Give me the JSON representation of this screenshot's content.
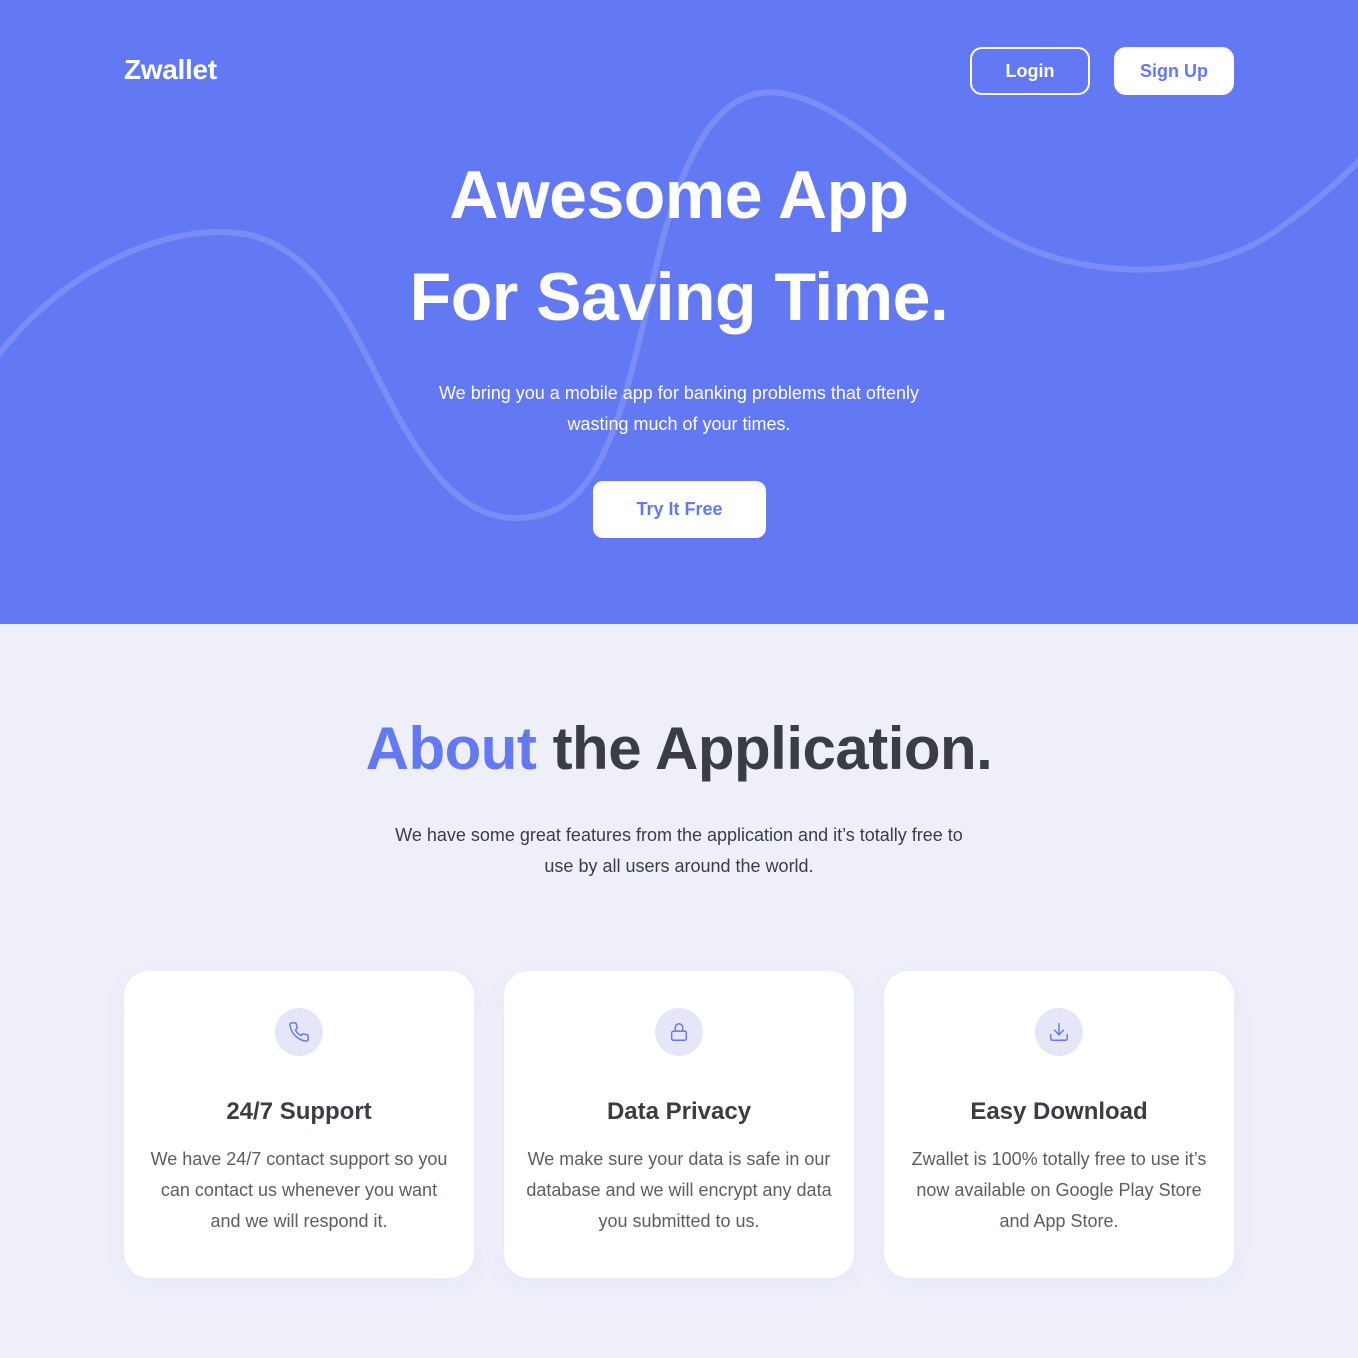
{
  "brand": {
    "name": "Zwallet"
  },
  "nav": {
    "login_label": "Login",
    "signup_label": "Sign Up"
  },
  "hero": {
    "title_line1": "Awesome App",
    "title_line2": "For Saving Time.",
    "description": "We bring you a mobile app for banking problems that oftenly wasting much of your times.",
    "cta_label": "Try It Free"
  },
  "about": {
    "title_accent": "About",
    "title_rest": " the Application.",
    "description": "We have some great features from the application and it’s totally free to use by all users around the world."
  },
  "features": [
    {
      "icon": "phone-icon",
      "title": "24/7 Support",
      "description": "We have 24/7 contact support so you can contact us whenever you want and we will respond it."
    },
    {
      "icon": "lock-icon",
      "title": "Data Privacy",
      "description": "We make sure your data is safe in our database and we will encrypt any data you submitted to us."
    },
    {
      "icon": "download-icon",
      "title": "Easy Download",
      "description": "Zwallet is 100% totally free to use it’s now available on Google Play Store and App Store."
    }
  ],
  "colors": {
    "primary": "#6379F4",
    "background": "#F0F0FA",
    "text_dark": "#3A3D42",
    "white": "#FFFFFF"
  }
}
